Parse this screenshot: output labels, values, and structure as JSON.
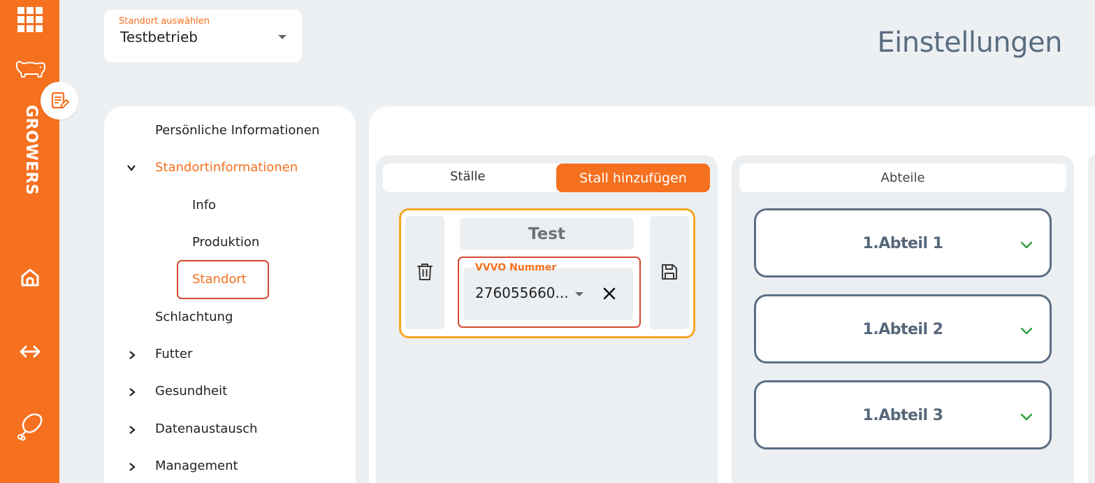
{
  "app": {
    "brand_name": "GROWERS",
    "colors": {
      "accent": "#f5701f",
      "highlight_border": "#d24a30",
      "stall_border": "#f6a623",
      "abteil_border": "#5b6e82",
      "chevron_green": "#2e9e3a"
    }
  },
  "sidebar": {
    "icons": [
      "grid-icon",
      "pig-icon",
      "home-icon",
      "exchange-icon",
      "ham-icon"
    ],
    "floating_icon": "notes-edit-icon"
  },
  "location": {
    "label": "Standort auswählen",
    "selected": "Testbetrieb"
  },
  "page": {
    "title": "Einstellungen"
  },
  "menu": {
    "items": [
      {
        "label": "Persönliche Informationen"
      },
      {
        "label": "Standortinformationen",
        "expanded": true,
        "active": true
      },
      {
        "label": "Info"
      },
      {
        "label": "Produktion"
      },
      {
        "label": "Standort",
        "active": true
      },
      {
        "label": "Schlachtung"
      },
      {
        "label": "Futter",
        "expandable": true
      },
      {
        "label": "Gesundheit",
        "expandable": true
      },
      {
        "label": "Datenaustausch",
        "expandable": true
      },
      {
        "label": "Management",
        "expandable": true
      }
    ]
  },
  "staelle": {
    "tab_label": "Ställe",
    "add_button": "Stall hinzufügen",
    "card": {
      "name": "Test",
      "vvvo_label": "VVVO Nummer",
      "vvvo_value": "276055660..."
    }
  },
  "abteile": {
    "header": "Abteile",
    "items": [
      {
        "label": "1.Abteil 1"
      },
      {
        "label": "1.Abteil 2"
      },
      {
        "label": "1.Abteil 3"
      }
    ]
  }
}
